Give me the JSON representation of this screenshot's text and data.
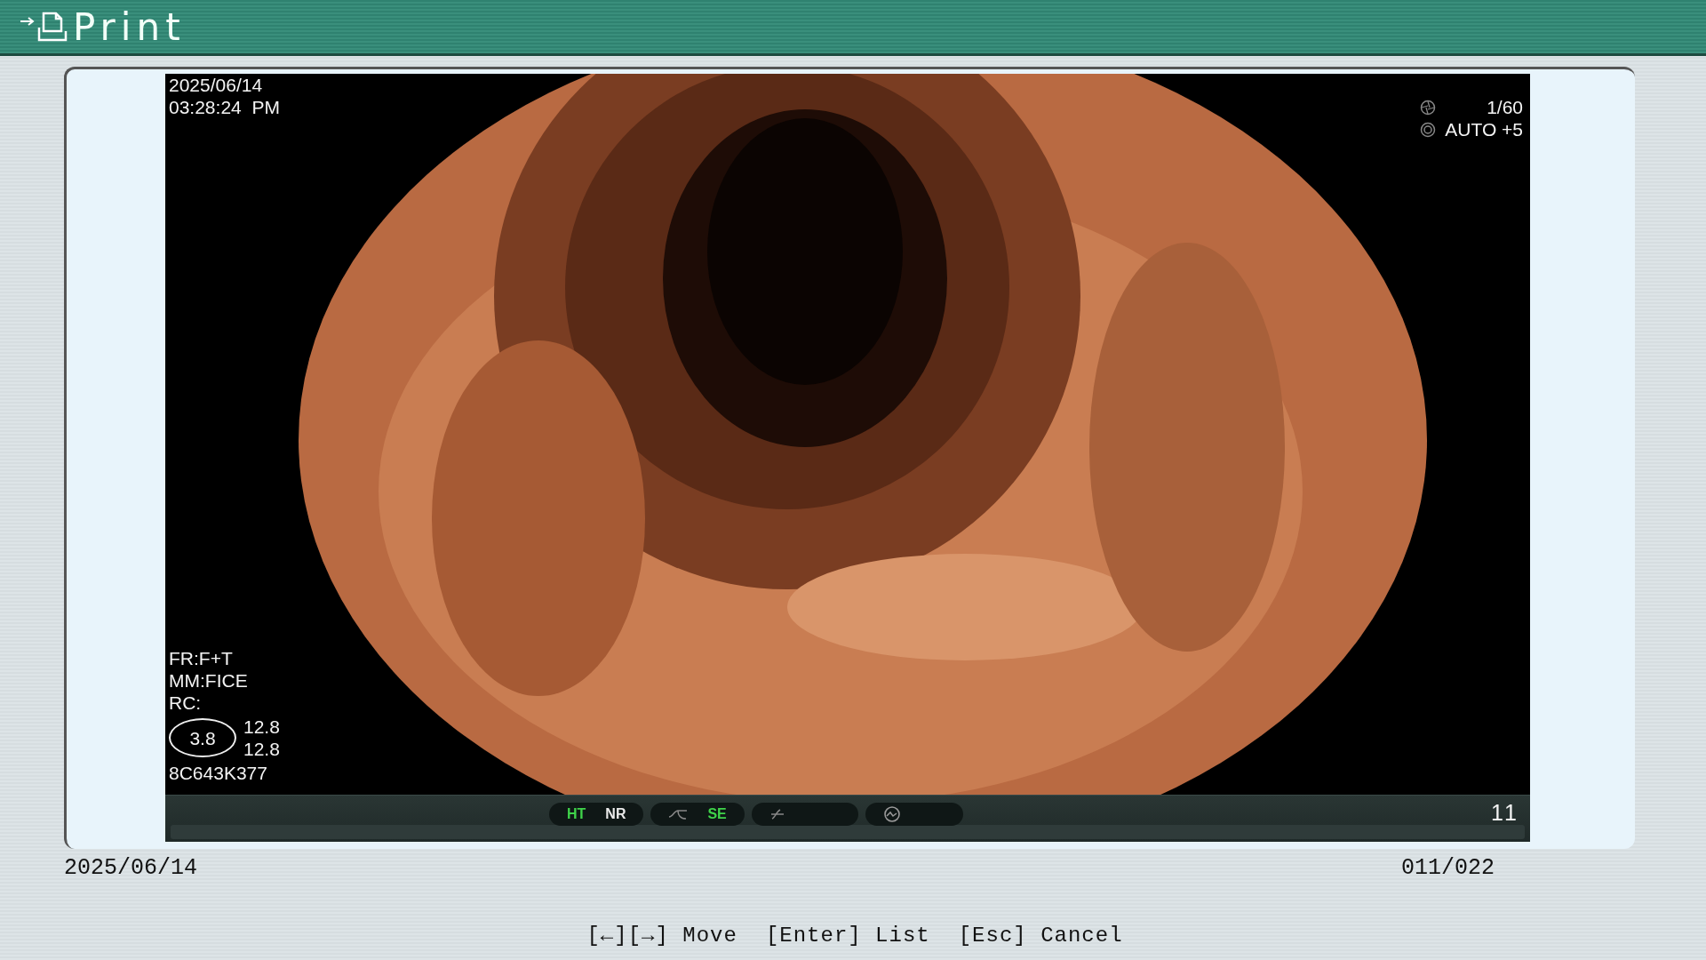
{
  "title": "Print",
  "viewer": {
    "date": "2025/06/14",
    "time": "03:28:24  PM",
    "shutter": "1/60",
    "iris": "AUTO +5",
    "info_lines": [
      "FR:F+T",
      "MM:FICE",
      "RC:"
    ],
    "zoom_value": "3.8",
    "readings": [
      "12.8",
      "12.8"
    ],
    "scope_id": "8C643K377",
    "frame_number": "11",
    "indicator_groups": [
      {
        "items": [
          {
            "kind": "label",
            "label": "HT",
            "on": true
          },
          {
            "kind": "label",
            "label": "NR",
            "on": false
          }
        ]
      },
      {
        "items": [
          {
            "kind": "tone"
          },
          {
            "kind": "label",
            "label": "SE",
            "on": true
          }
        ]
      },
      {
        "items": [
          {
            "kind": "enhance"
          }
        ]
      },
      {
        "items": [
          {
            "kind": "gauge"
          }
        ]
      }
    ]
  },
  "footer": {
    "date": "2025/06/14",
    "counter": "011/022"
  },
  "hints": [
    "[←][→] Move",
    "[Enter] List",
    "[Esc] Cancel"
  ]
}
